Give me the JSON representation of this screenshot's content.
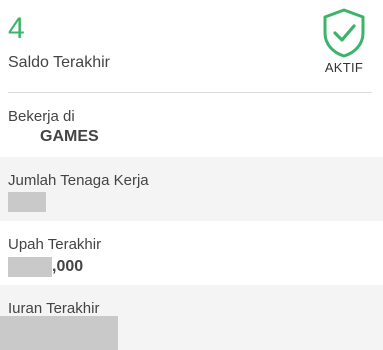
{
  "summary": {
    "balance_value": "4",
    "balance_label": "Saldo Terakhir",
    "status_label": "AKTIF",
    "status_icon": "shield-check-icon",
    "accent_color": "#3bb36a"
  },
  "details": {
    "workplace": {
      "label": "Bekerja di",
      "value": "GAMES"
    },
    "workforce": {
      "label": "Jumlah Tenaga Kerja"
    },
    "wage": {
      "label": "Upah Terakhir",
      "value_suffix": ",000"
    },
    "contribution": {
      "label": "Iuran Terakhir"
    }
  }
}
